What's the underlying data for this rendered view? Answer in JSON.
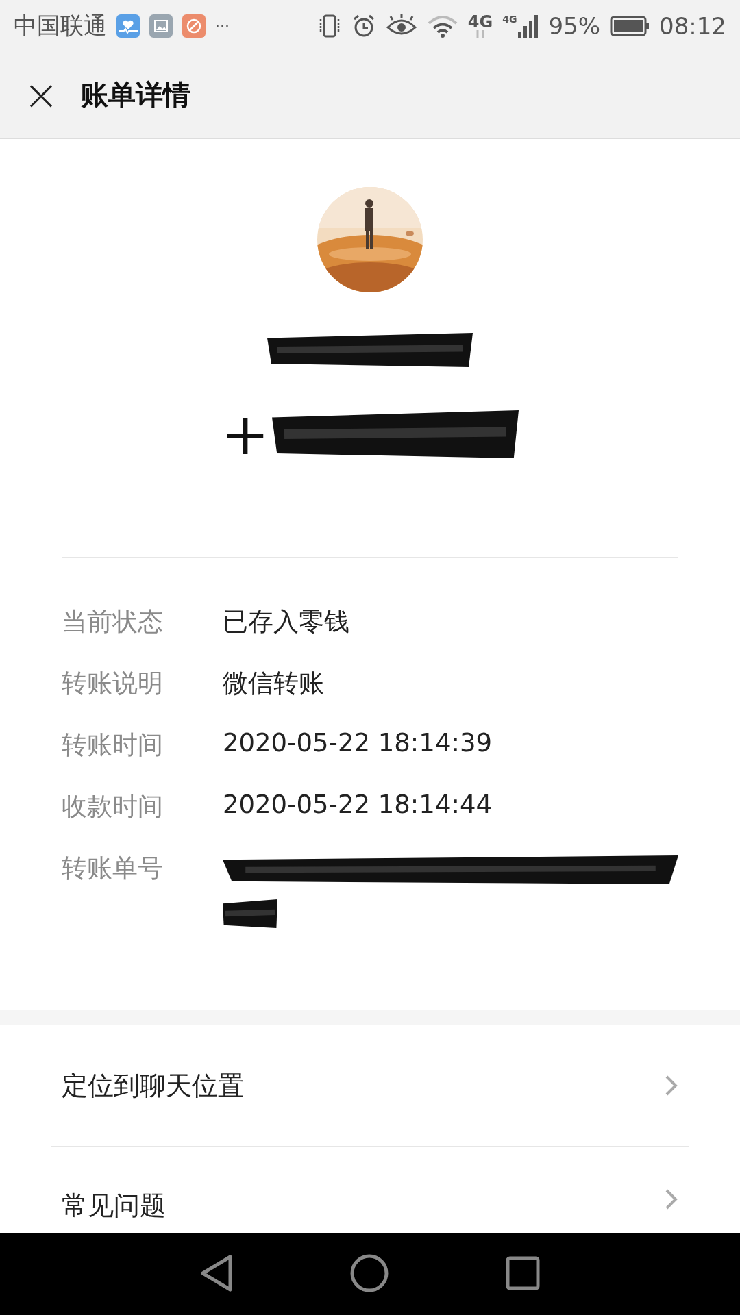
{
  "status_bar": {
    "carrier": "中国联通",
    "more": "···",
    "network": "4G",
    "network_small": "4G",
    "battery": "95%",
    "time": "08:12"
  },
  "header": {
    "close": "×",
    "title": "账单详情"
  },
  "summary": {
    "payer_redacted": true,
    "amount_sign": "+",
    "amount_redacted": true
  },
  "details": [
    {
      "label": "当前状态",
      "value": "已存入零钱",
      "redacted": false
    },
    {
      "label": "转账说明",
      "value": "微信转账",
      "redacted": false
    },
    {
      "label": "转账时间",
      "value": "2020-05-22 18:14:39",
      "redacted": false
    },
    {
      "label": "收款时间",
      "value": "2020-05-22 18:14:44",
      "redacted": false
    },
    {
      "label": "转账单号",
      "redacted": true
    }
  ],
  "links": [
    {
      "label": "定位到聊天位置"
    },
    {
      "label": "常见问题"
    }
  ]
}
